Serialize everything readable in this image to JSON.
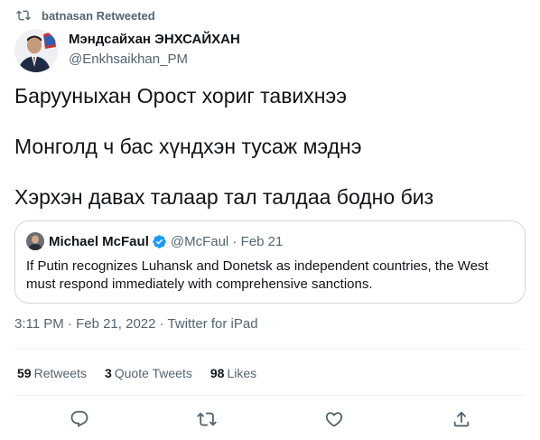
{
  "retweet_context": {
    "text": "batnasan Retweeted"
  },
  "author": {
    "display_name": "Мэндсайхан ЭНХСАЙХАН",
    "handle": "@Enkhsaikhan_PM"
  },
  "tweet": {
    "lines": [
      "Барууныхан Орост хориг тавихнээ",
      "Монголд ч бас хүндхэн тусаж мэднэ",
      "Хэрхэн давах талаар тал талдаа бодно биз"
    ]
  },
  "quote": {
    "display_name": "Michael McFaul",
    "meta": "@McFaul · Feb 21",
    "text": "If Putin recognizes Luhansk and Donetsk as independent countries, the West must respond immediately with comprehensive sanctions."
  },
  "timestamp": "3:11 PM · Feb 21, 2022 · Twitter for iPad",
  "stats": {
    "retweets_count": "59",
    "retweets_label": "Retweets",
    "quotes_count": "3",
    "quotes_label": "Quote Tweets",
    "likes_count": "98",
    "likes_label": "Likes"
  },
  "icons": {
    "retweet": "retweet-icon",
    "reply": "reply-icon",
    "like": "heart-icon",
    "share": "share-icon",
    "verified": "verified-badge-icon"
  },
  "colors": {
    "secondary_text": "#536471",
    "verified": "#1d9bf0",
    "border": "#cfd9de"
  }
}
